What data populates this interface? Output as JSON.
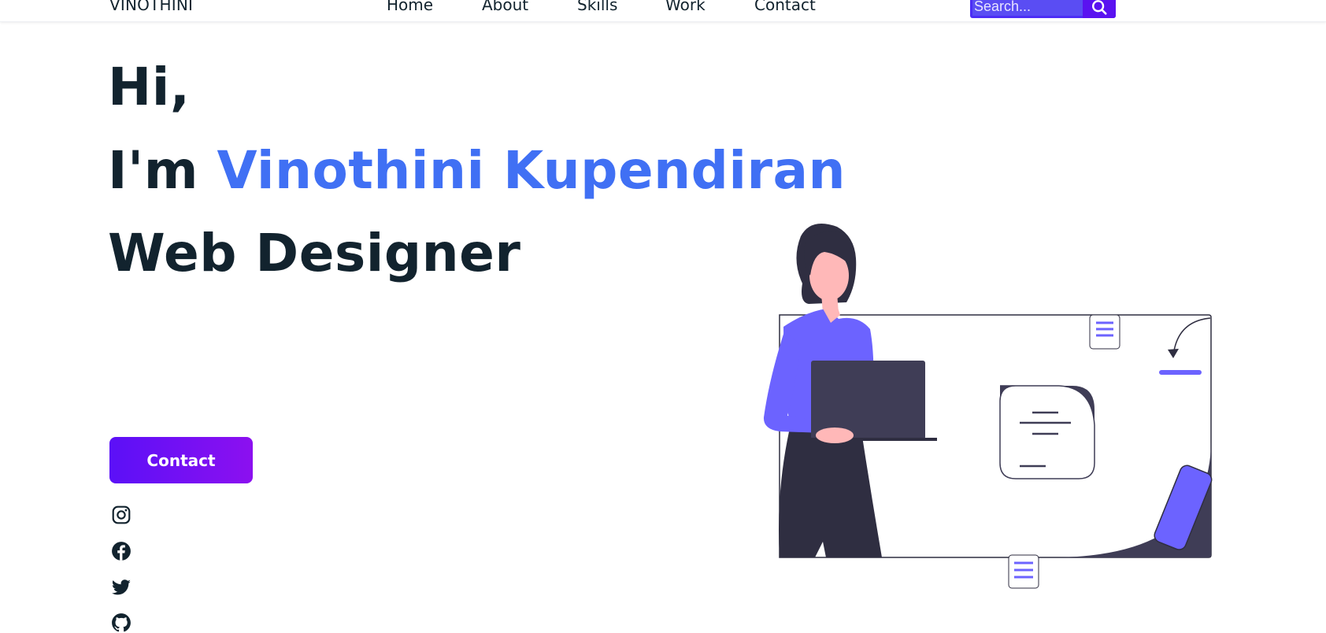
{
  "header": {
    "logo": "VINOTHINI",
    "nav": [
      {
        "label": "Home"
      },
      {
        "label": "About"
      },
      {
        "label": "Skills"
      },
      {
        "label": "Work"
      },
      {
        "label": "Contact"
      }
    ],
    "search": {
      "placeholder": "Search...",
      "icon": "search-icon"
    }
  },
  "hero": {
    "greeting": "Hi,",
    "intro": "I'm ",
    "name": "Vinothini Kupendiran",
    "role": "Web Designer",
    "contact_button": "Contact"
  },
  "social": [
    {
      "icon": "instagram-icon"
    },
    {
      "icon": "facebook-icon"
    },
    {
      "icon": "twitter-icon"
    },
    {
      "icon": "github-icon"
    }
  ],
  "colors": {
    "accent": "#4070f4",
    "heading": "#12232e",
    "button_start": "#5b10f7",
    "button_end": "#8c10f0",
    "illustration_purple": "#6c63ff",
    "illustration_dark": "#2f2e41"
  }
}
